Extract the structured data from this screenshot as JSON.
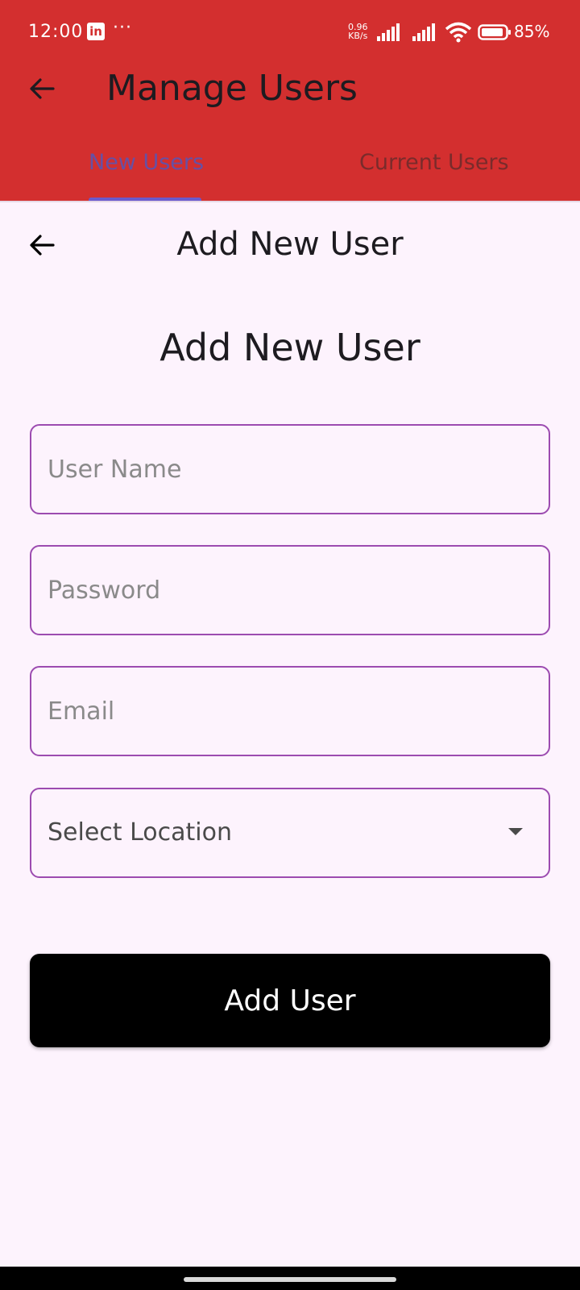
{
  "status_bar": {
    "time": "12:00",
    "linkedin_icon": "in",
    "more_dots": "···",
    "net_speed_value": "0.96",
    "net_speed_unit": "KB/s",
    "battery": "85%"
  },
  "app_bar": {
    "title": "Manage Users",
    "back_icon": "arrow-left-icon",
    "color": "#d32f2f"
  },
  "tabs": [
    {
      "label": "New Users",
      "selected": true
    },
    {
      "label": "Current Users",
      "selected": false
    }
  ],
  "page": {
    "title": "Add New User",
    "back_icon": "arrow-left-icon"
  },
  "form": {
    "title": "Add New User",
    "username_placeholder": "User Name",
    "password_placeholder": "Password",
    "email_placeholder": "Email",
    "location_label": "Select Location",
    "submit_label": "Add User",
    "border_color": "#9c4bb0"
  }
}
